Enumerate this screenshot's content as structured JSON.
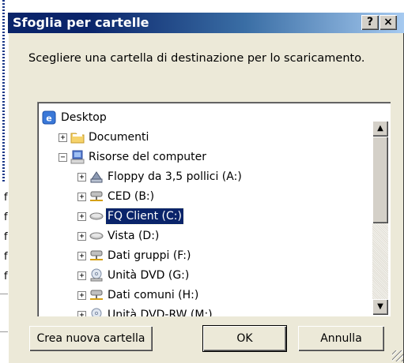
{
  "background": {
    "letters": [
      "f",
      "f",
      "f",
      "f",
      "f"
    ]
  },
  "dialog": {
    "title": "Sfoglia per cartelle",
    "help_label": "?",
    "close_label": "×",
    "instruction": "Scegliere una cartella di destinazione per lo scaricamento.",
    "tree": [
      {
        "label": "Desktop",
        "icon": "desktop-icon",
        "expander": "",
        "level": 0,
        "selected": false
      },
      {
        "label": "Documenti",
        "icon": "folder-icon",
        "expander": "+",
        "level": 1,
        "selected": false
      },
      {
        "label": "Risorse del computer",
        "icon": "computer-icon",
        "expander": "−",
        "level": 1,
        "selected": false
      },
      {
        "label": "Floppy da 3,5 pollici (A:)",
        "icon": "floppy-icon",
        "expander": "+",
        "level": 2,
        "selected": false
      },
      {
        "label": "CED (B:)",
        "icon": "network-drive-icon",
        "expander": "+",
        "level": 2,
        "selected": false
      },
      {
        "label": "FQ Client (C:)",
        "icon": "hard-drive-icon",
        "expander": "+",
        "level": 2,
        "selected": true
      },
      {
        "label": "Vista (D:)",
        "icon": "hard-drive-icon",
        "expander": "+",
        "level": 2,
        "selected": false
      },
      {
        "label": "Dati gruppi (F:)",
        "icon": "network-drive-icon",
        "expander": "+",
        "level": 2,
        "selected": false
      },
      {
        "label": "Unità DVD (G:)",
        "icon": "dvd-drive-icon",
        "expander": "+",
        "level": 2,
        "selected": false
      },
      {
        "label": "Dati comuni (H:)",
        "icon": "network-drive-icon",
        "expander": "+",
        "level": 2,
        "selected": false
      },
      {
        "label": "Unità DVD-RW (M:)",
        "icon": "dvd-drive-icon",
        "expander": "+",
        "level": 2,
        "selected": false
      }
    ],
    "buttons": {
      "new_folder": "Crea nuova cartella",
      "ok": "OK",
      "cancel": "Annulla"
    }
  },
  "colors": {
    "titlebar": "#0a246a",
    "face": "#ece9d8",
    "selection": "#0a246a"
  }
}
